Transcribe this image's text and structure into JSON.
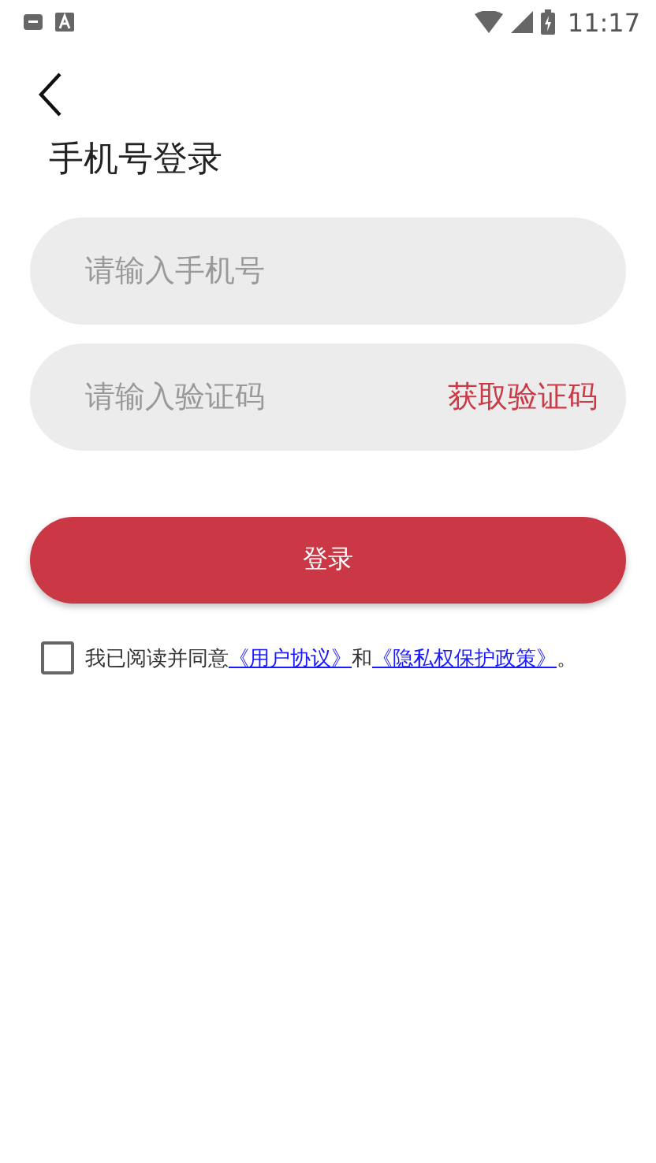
{
  "status_bar": {
    "time": "11:17"
  },
  "title": "手机号登录",
  "phone_field": {
    "placeholder": "请输入手机号"
  },
  "code_field": {
    "placeholder": "请输入验证码"
  },
  "get_code_button": "获取验证码",
  "login_button": "登录",
  "agreement": {
    "checked": false,
    "parts": [
      {
        "kind": "text",
        "text": "我已阅读并同意"
      },
      {
        "kind": "link",
        "text": "《用户协议》"
      },
      {
        "kind": "text",
        "text": "和"
      },
      {
        "kind": "link",
        "text": "《隐私权保护政策》"
      },
      {
        "kind": "text",
        "text": "。"
      }
    ]
  }
}
